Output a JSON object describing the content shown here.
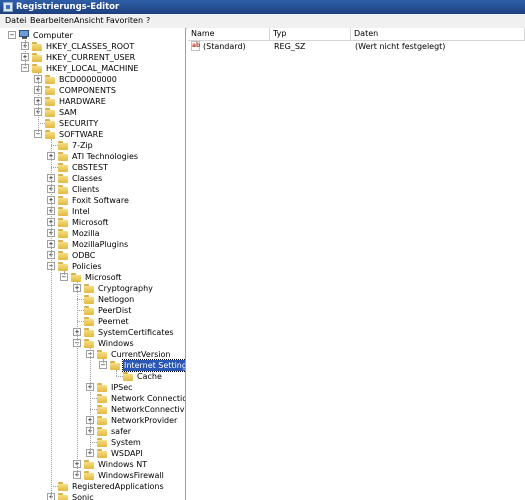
{
  "window": {
    "title": "Registrierungs-Editor"
  },
  "menu": [
    "Datei",
    "Bearbeiten",
    "Ansicht",
    "Favoriten",
    "?"
  ],
  "list": {
    "columns": [
      "Name",
      "Typ",
      "Daten"
    ],
    "rows": [
      {
        "name": "(Standard)",
        "type": "REG_SZ",
        "data": "(Wert nicht festgelegt)",
        "icon": "string-value-icon"
      }
    ]
  },
  "tree": [
    {
      "label": "Computer",
      "level": 0,
      "exp": "-",
      "icon": "computer"
    },
    {
      "label": "HKEY_CLASSES_ROOT",
      "level": 1,
      "exp": "+"
    },
    {
      "label": "HKEY_CURRENT_USER",
      "level": 1,
      "exp": "+"
    },
    {
      "label": "HKEY_LOCAL_MACHINE",
      "level": 1,
      "exp": "-"
    },
    {
      "label": "BCD00000000",
      "level": 2,
      "exp": "+"
    },
    {
      "label": "COMPONENTS",
      "level": 2,
      "exp": "+"
    },
    {
      "label": "HARDWARE",
      "level": 2,
      "exp": "+"
    },
    {
      "label": "SAM",
      "level": 2,
      "exp": "+"
    },
    {
      "label": "SECURITY",
      "level": 2,
      "exp": ""
    },
    {
      "label": "SOFTWARE",
      "level": 2,
      "exp": "-"
    },
    {
      "label": "7-Zip",
      "level": 3,
      "exp": ""
    },
    {
      "label": "ATI Technologies",
      "level": 3,
      "exp": "+"
    },
    {
      "label": "CBSTEST",
      "level": 3,
      "exp": ""
    },
    {
      "label": "Classes",
      "level": 3,
      "exp": "+"
    },
    {
      "label": "Clients",
      "level": 3,
      "exp": "+"
    },
    {
      "label": "Foxit Software",
      "level": 3,
      "exp": "+"
    },
    {
      "label": "Intel",
      "level": 3,
      "exp": "+"
    },
    {
      "label": "Microsoft",
      "level": 3,
      "exp": "+"
    },
    {
      "label": "Mozilla",
      "level": 3,
      "exp": "+"
    },
    {
      "label": "MozillaPlugins",
      "level": 3,
      "exp": "+"
    },
    {
      "label": "ODBC",
      "level": 3,
      "exp": "+"
    },
    {
      "label": "Policies",
      "level": 3,
      "exp": "-"
    },
    {
      "label": "Microsoft",
      "level": 4,
      "exp": "-"
    },
    {
      "label": "Cryptography",
      "level": 5,
      "exp": "+"
    },
    {
      "label": "Netlogon",
      "level": 5,
      "exp": ""
    },
    {
      "label": "PeerDist",
      "level": 5,
      "exp": ""
    },
    {
      "label": "Peernet",
      "level": 5,
      "exp": ""
    },
    {
      "label": "SystemCertificates",
      "level": 5,
      "exp": "+"
    },
    {
      "label": "Windows",
      "level": 5,
      "exp": "-"
    },
    {
      "label": "CurrentVersion",
      "level": 6,
      "exp": "-"
    },
    {
      "label": "Internet Settings",
      "level": 7,
      "exp": "-",
      "selected": true
    },
    {
      "label": "Cache",
      "level": 8,
      "exp": ""
    },
    {
      "label": "IPSec",
      "level": 6,
      "exp": "+"
    },
    {
      "label": "Network Connections",
      "level": 6,
      "exp": ""
    },
    {
      "label": "NetworkConnectivitySt",
      "level": 6,
      "exp": ""
    },
    {
      "label": "NetworkProvider",
      "level": 6,
      "exp": "+"
    },
    {
      "label": "safer",
      "level": 6,
      "exp": "+"
    },
    {
      "label": "System",
      "level": 6,
      "exp": ""
    },
    {
      "label": "WSDAPI",
      "level": 6,
      "exp": "+"
    },
    {
      "label": "Windows NT",
      "level": 5,
      "exp": "+"
    },
    {
      "label": "WindowsFirewall",
      "level": 5,
      "exp": "+"
    },
    {
      "label": "RegisteredApplications",
      "level": 3,
      "exp": ""
    },
    {
      "label": "Sonic",
      "level": 3,
      "exp": "+"
    }
  ]
}
